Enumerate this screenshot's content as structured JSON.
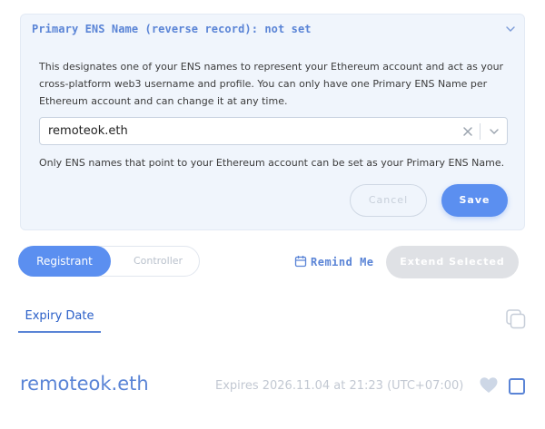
{
  "panel": {
    "title": "Primary ENS Name (reverse record): not set",
    "description": "This designates one of your ENS names to represent your Ethereum account and act as your cross-platform web3 username and profile. You can only have one Primary ENS Name per Ethereum account and can change it at any time.",
    "select_value": "remoteok.eth",
    "note": "Only ENS names that point to your Ethereum account can be set as your Primary ENS Name.",
    "cancel_label": "Cancel",
    "save_label": "Save"
  },
  "toggle": {
    "active_label": "Registrant",
    "inactive_label": "Controller"
  },
  "actions": {
    "remind_label": "Remind Me",
    "extend_label": "Extend Selected"
  },
  "tabs": {
    "expiry_label": "Expiry Date"
  },
  "row": {
    "name": "remoteok.eth",
    "expires": "Expires 2026.11.04 at 21:23 (UTC+07:00)"
  },
  "icons": {
    "collapse": "chevron-down-icon",
    "clear": "close-icon",
    "dropdown": "chevron-down-icon",
    "calendar": "calendar-icon",
    "copy": "copy-icon",
    "favorite": "heart-icon"
  },
  "colors": {
    "accent": "#5b8ff0",
    "link": "#5a84d6",
    "panel_bg": "#f0f5fc",
    "disabled": "#dfe1e5"
  }
}
